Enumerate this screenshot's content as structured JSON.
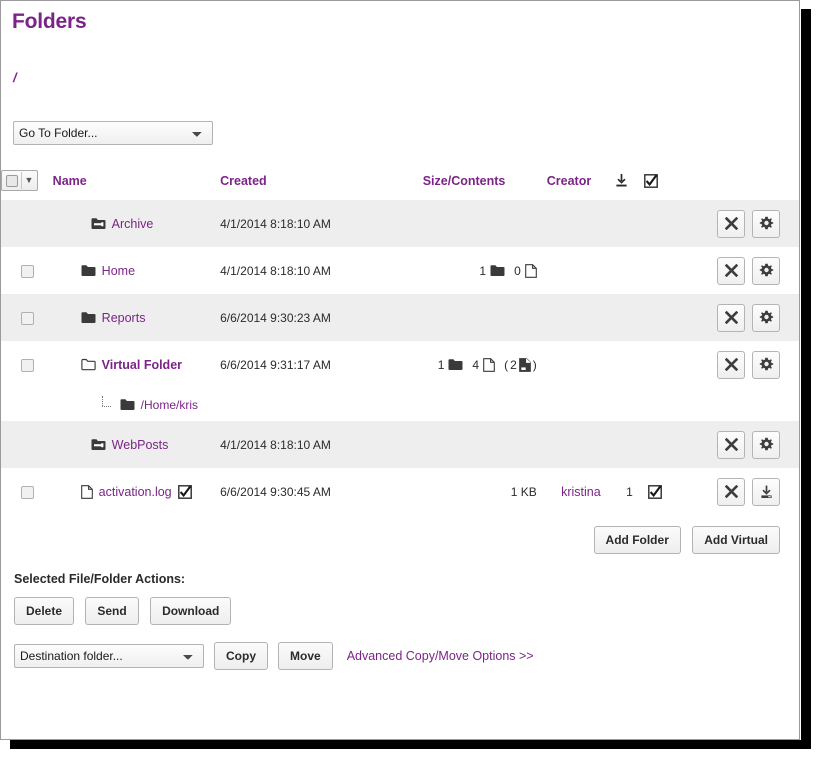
{
  "page": {
    "title": "Folders",
    "breadcrumb": "/"
  },
  "colors": {
    "accent_purple": "#7b2487",
    "row_alt_bg": "#eeeeee",
    "text": "#2b2b2b"
  },
  "goto": {
    "selected": "Go To Folder...",
    "options": [
      "Go To Folder..."
    ]
  },
  "table": {
    "headers": {
      "name": "Name",
      "created": "Created",
      "size": "Size/Contents",
      "creator": "Creator",
      "download_icon": "download-icon",
      "check_icon": "checked-box-icon"
    },
    "rows": [
      {
        "name": "Archive",
        "icon": "special-folder-icon",
        "has_checkbox": false,
        "bold": false,
        "created": "4/1/2014 8:18:10 AM",
        "folder_count": "",
        "file_count": "",
        "extra_count": "",
        "size": "",
        "creator": "",
        "num": "",
        "has_check_icon": false,
        "actions": [
          "delete-icon",
          "gear-icon"
        ],
        "alt": true
      },
      {
        "name": "Home",
        "icon": "folder-icon",
        "has_checkbox": true,
        "bold": false,
        "created": "4/1/2014 8:18:10 AM",
        "folder_count": "1",
        "file_count": "0",
        "extra_count": "",
        "size": "",
        "creator": "",
        "num": "",
        "has_check_icon": false,
        "actions": [
          "delete-icon",
          "gear-icon"
        ],
        "alt": false
      },
      {
        "name": "Reports",
        "icon": "folder-icon",
        "has_checkbox": true,
        "bold": false,
        "created": "6/6/2014 9:30:23 AM",
        "folder_count": "",
        "file_count": "",
        "extra_count": "",
        "size": "",
        "creator": "",
        "num": "",
        "has_check_icon": false,
        "actions": [
          "delete-icon",
          "gear-icon"
        ],
        "alt": true
      },
      {
        "name": "Virtual Folder",
        "icon": "virtual-folder-icon",
        "has_checkbox": true,
        "bold": true,
        "created": "6/6/2014 9:31:17 AM",
        "folder_count": "1",
        "file_count": "4",
        "extra_count": "2",
        "size": "",
        "creator": "",
        "num": "",
        "has_check_icon": false,
        "actions": [
          "delete-icon",
          "gear-icon"
        ],
        "alt": false
      },
      {
        "name": "/Home/kris",
        "icon": "folder-icon",
        "is_sub": true,
        "has_checkbox": false,
        "bold": false,
        "created": "",
        "folder_count": "",
        "file_count": "",
        "extra_count": "",
        "size": "",
        "creator": "",
        "num": "",
        "has_check_icon": false,
        "actions": [],
        "alt": false
      },
      {
        "name": "WebPosts",
        "icon": "special-folder-icon",
        "has_checkbox": false,
        "bold": false,
        "created": "4/1/2014 8:18:10 AM",
        "folder_count": "",
        "file_count": "",
        "extra_count": "",
        "size": "",
        "creator": "",
        "num": "",
        "has_check_icon": false,
        "actions": [
          "delete-icon",
          "gear-icon"
        ],
        "alt": true
      },
      {
        "name": "activation.log",
        "icon": "file-icon",
        "name_badge": "checked-box-icon",
        "has_checkbox": true,
        "bold": false,
        "created": "6/6/2014 9:30:45 AM",
        "folder_count": "",
        "file_count": "",
        "extra_count": "",
        "size": "1 KB",
        "creator": "kristina",
        "num": "1",
        "has_check_icon": true,
        "actions": [
          "delete-icon",
          "download-icon"
        ],
        "alt": false
      }
    ]
  },
  "buttons": {
    "add_folder": "Add Folder",
    "add_virtual": "Add Virtual",
    "delete": "Delete",
    "send": "Send",
    "download": "Download",
    "copy": "Copy",
    "move": "Move"
  },
  "actions": {
    "label": "Selected File/Folder Actions:",
    "advanced_link": "Advanced Copy/Move Options >>"
  },
  "destination": {
    "selected": "Destination folder...",
    "options": [
      "Destination folder..."
    ]
  }
}
